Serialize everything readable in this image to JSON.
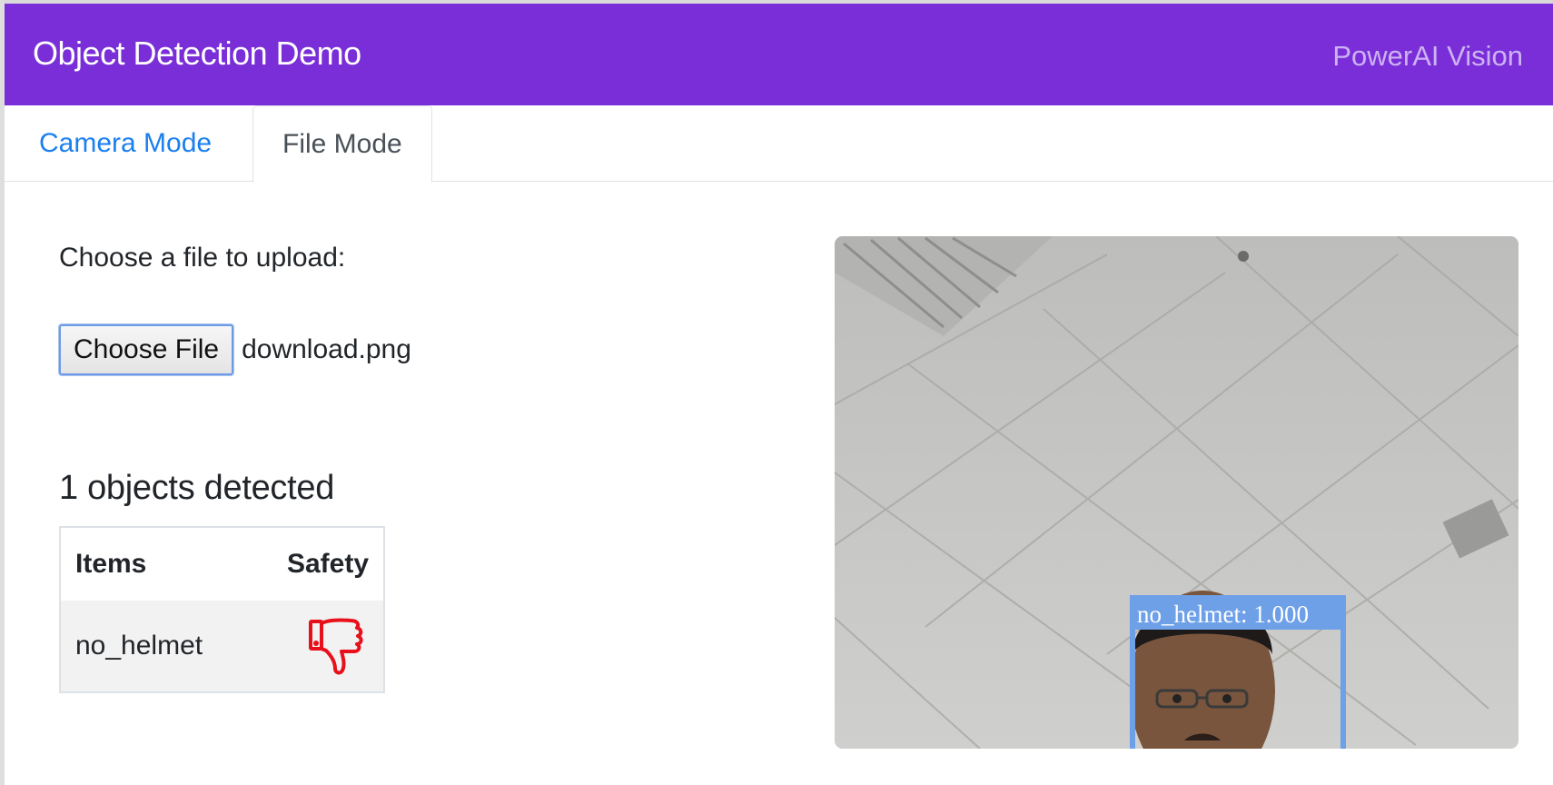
{
  "header": {
    "title": "Object Detection Demo",
    "right_label": "PowerAI Vision",
    "background": "#7a2ed8"
  },
  "tabs": [
    {
      "label": "Camera Mode",
      "active": false
    },
    {
      "label": "File Mode",
      "active": true
    }
  ],
  "upload": {
    "label": "Choose a file to upload:",
    "button_label": "Choose File",
    "file_name": "download.png"
  },
  "results": {
    "heading": "1 objects detected",
    "columns": [
      "Items",
      "Safety"
    ],
    "rows": [
      {
        "item": "no_helmet",
        "safety_icon": "thumbs-down-icon",
        "safety_color": "#e8101a"
      }
    ]
  },
  "detection_image": {
    "boxes": [
      {
        "label": "no_helmet: 1.000",
        "color": "#6ea0e8"
      }
    ]
  }
}
